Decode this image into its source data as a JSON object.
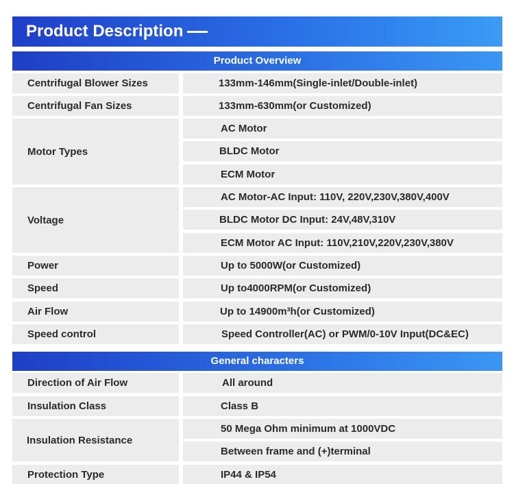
{
  "header": {
    "title": "Product Description"
  },
  "overview": {
    "heading": "Product Overview",
    "blower_label": "Centrifugal Blower Sizes",
    "blower_value": "133mm-146mm(Single-inlet/Double-inlet)",
    "fan_label": "Centrifugal Fan Sizes",
    "fan_value": "133mm-630mm(or Customized)",
    "motor_label": "Motor Types",
    "motor_values": [
      "AC Motor",
      "BLDC Motor",
      "ECM Motor"
    ],
    "voltage_label": "Voltage",
    "voltage_values": [
      "AC Motor-AC Input: 110V, 220V,230V,380V,400V",
      "BLDC Motor DC Input: 24V,48V,310V",
      "ECM Motor AC Input: 110V,210V,220V,230V,380V"
    ],
    "power_label": "Power",
    "power_value": "Up to 5000W(or Customized)",
    "speed_label": "Speed",
    "speed_value": "Up to4000RPM(or Customized)",
    "airflow_label": "Air Flow",
    "airflow_value": "Up to 14900m³h(or Customized)",
    "speedctl_label": "Speed control",
    "speedctl_value": "Speed Controller(AC) or PWM/0-10V Input(DC&EC)"
  },
  "general": {
    "heading": "General characters",
    "direction_label": "Direction of Air Flow",
    "direction_value": "All around",
    "insclass_label": "Insulation Class",
    "insclass_value": "Class B",
    "insres_label": "Insulation Resistance",
    "insres_values": [
      "50 Mega Ohm minimum at 1000VDC",
      "Between frame and (+)terminal"
    ],
    "protection_label": "Protection Type",
    "protection_value": "IP44 & IP54"
  }
}
